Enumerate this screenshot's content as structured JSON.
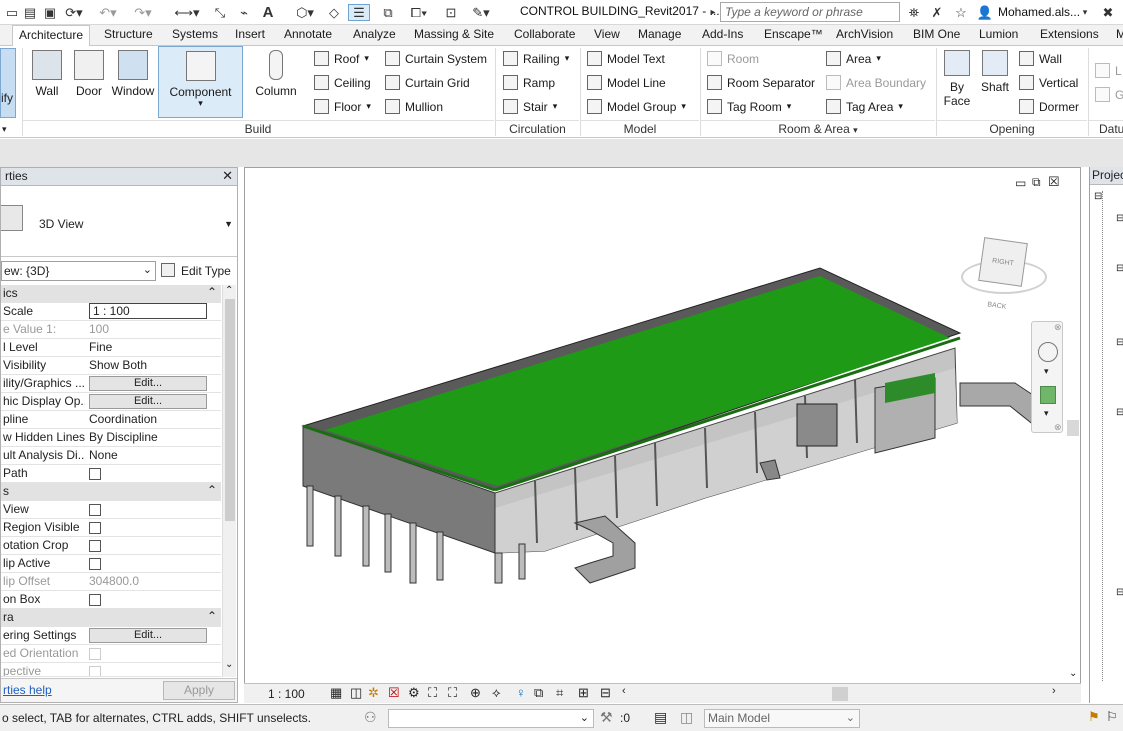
{
  "qat": {
    "title": "CONTROL BUILDING_Revit2017 - ...",
    "search_placeholder": "Type a keyword or phrase",
    "user": "Mohamed.als..."
  },
  "tabs": [
    "Architecture",
    "Structure",
    "Systems",
    "Insert",
    "Annotate",
    "Analyze",
    "Massing & Site",
    "Collaborate",
    "View",
    "Manage",
    "Add-Ins",
    "Enscape™",
    "ArchVision",
    "BIM One",
    "Lumion",
    "Extensions"
  ],
  "ribbon": {
    "modify_label": "ify",
    "build": {
      "title": "Build",
      "wall": "Wall",
      "door": "Door",
      "window": "Window",
      "component": "Component",
      "column": "Column",
      "roof": "Roof",
      "ceiling": "Ceiling",
      "floor": "Floor",
      "curtain_system": "Curtain System",
      "curtain_grid": "Curtain Grid",
      "mullion": "Mullion"
    },
    "circulation": {
      "title": "Circulation",
      "railing": "Railing",
      "ramp": "Ramp",
      "stair": "Stair"
    },
    "model": {
      "title": "Model",
      "model_text": "Model Text",
      "model_line": "Model Line",
      "model_group": "Model Group"
    },
    "room_area": {
      "title": "Room & Area",
      "room": "Room",
      "room_separator": "Room Separator",
      "tag_room": "Tag Room",
      "area": "Area",
      "area_boundary": "Area Boundary",
      "tag_area": "Tag Area"
    },
    "opening": {
      "title": "Opening",
      "by_face_1": "By",
      "by_face_2": "Face",
      "shaft": "Shaft",
      "wall": "Wall",
      "vertical": "Vertical",
      "dormer": "Dormer"
    },
    "datum": {
      "title": "Datu",
      "item1": "L",
      "item2": "G"
    }
  },
  "properties": {
    "title": "rties",
    "type_name": "3D View",
    "selector": "ew: {3D}",
    "edit_type": "Edit Type",
    "section_graphics": "ics",
    "rows": [
      {
        "k": " Scale",
        "v": "1 : 100"
      },
      {
        "k": "e Value   1:",
        "v": "100"
      },
      {
        "k": "l Level",
        "v": "Fine"
      },
      {
        "k": " Visibility",
        "v": "Show Both"
      },
      {
        "k": "ility/Graphics ...",
        "v": "Edit..."
      },
      {
        "k": "hic Display Op...",
        "v": "Edit..."
      },
      {
        "k": "pline",
        "v": "Coordination"
      },
      {
        "k": "w Hidden Lines",
        "v": "By Discipline"
      },
      {
        "k": "ult Analysis Di...",
        "v": "None"
      },
      {
        "k": "Path",
        "v": ""
      }
    ],
    "section_extents": "s",
    "rows2": [
      {
        "k": " View",
        "v": ""
      },
      {
        "k": " Region Visible",
        "v": ""
      },
      {
        "k": "otation Crop",
        "v": ""
      },
      {
        "k": "lip Active",
        "v": ""
      },
      {
        "k": "lip Offset",
        "v": "304800.0"
      },
      {
        "k": "on Box",
        "v": ""
      }
    ],
    "section_camera": "ra",
    "rows3": [
      {
        "k": "ering Settings",
        "v": "Edit..."
      },
      {
        "k": "ed Orientation",
        "v": ""
      },
      {
        "k": "pective",
        "v": ""
      }
    ],
    "help": "rties help",
    "apply": "Apply"
  },
  "view": {
    "scale": "1 : 100",
    "browser_title": "Projec"
  },
  "status": {
    "hint": "o select, TAB for alternates, CTRL adds, SHIFT unselects.",
    "filter": ":0",
    "workset": "Main Model"
  },
  "colors": {
    "roof": "#1f9a17",
    "ribbon_accent": "#0070c0"
  }
}
